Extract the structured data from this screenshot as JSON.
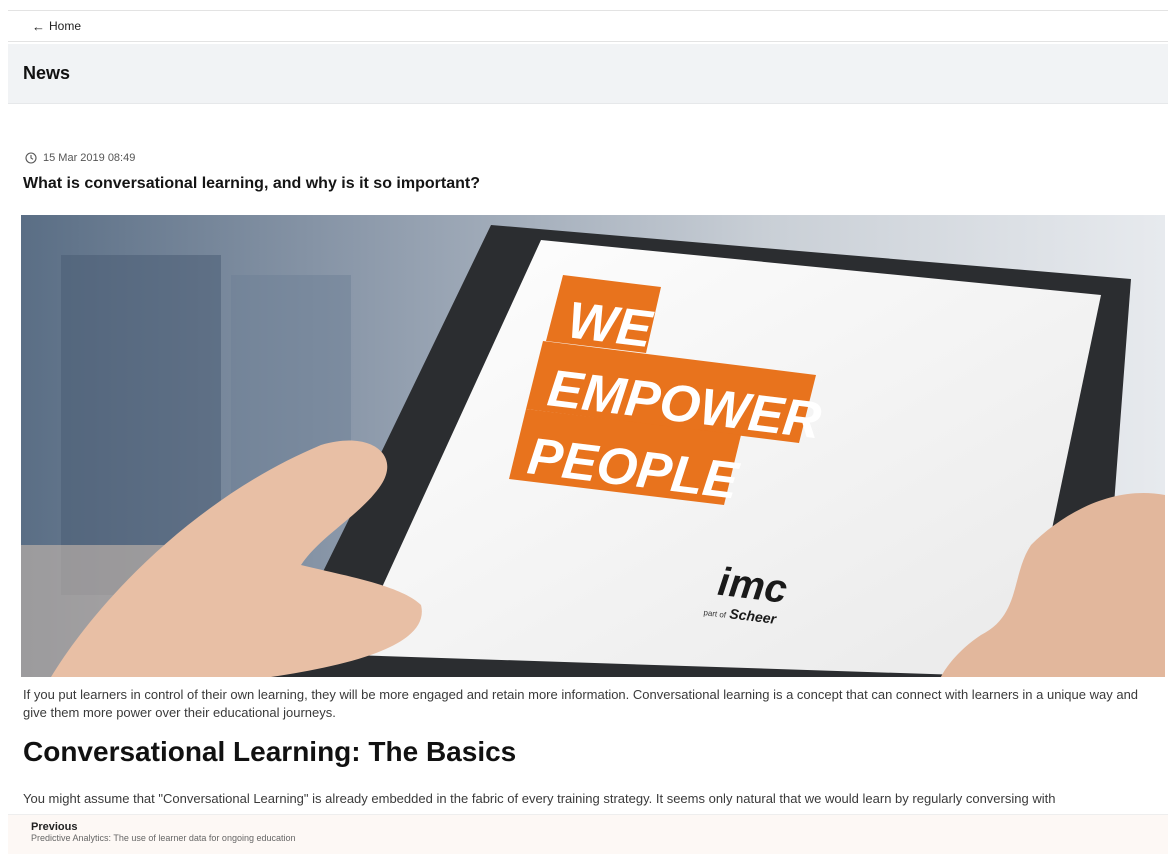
{
  "nav": {
    "back_arrow": "←",
    "back_label": "Home"
  },
  "header": {
    "title": "News"
  },
  "article": {
    "date": "15 Mar 2019 08:49",
    "title": "What is conversational learning, and why is it so important?",
    "image": {
      "slogan_lines": [
        "WE",
        "EMPOWER",
        "PEOPLE"
      ],
      "logo_main": "imc",
      "logo_sub_prefix": "part of",
      "logo_sub_name": "Scheer",
      "accent_color": "#e8731d"
    },
    "intro": "If you put learners in control of their own learning, they will be more engaged and retain more information. Conversational learning is a concept that can connect with learners in a unique way and give them more power over their educational journeys.",
    "section_heading": "Conversational Learning: The Basics",
    "body_start": "You might assume that \"Conversational Learning\" is already embedded in the fabric of every training strategy. It seems only natural that we would learn by regularly conversing with"
  },
  "footer": {
    "previous_label": "Previous",
    "previous_title": "Predictive Analytics: The use of learner data for ongoing education"
  }
}
